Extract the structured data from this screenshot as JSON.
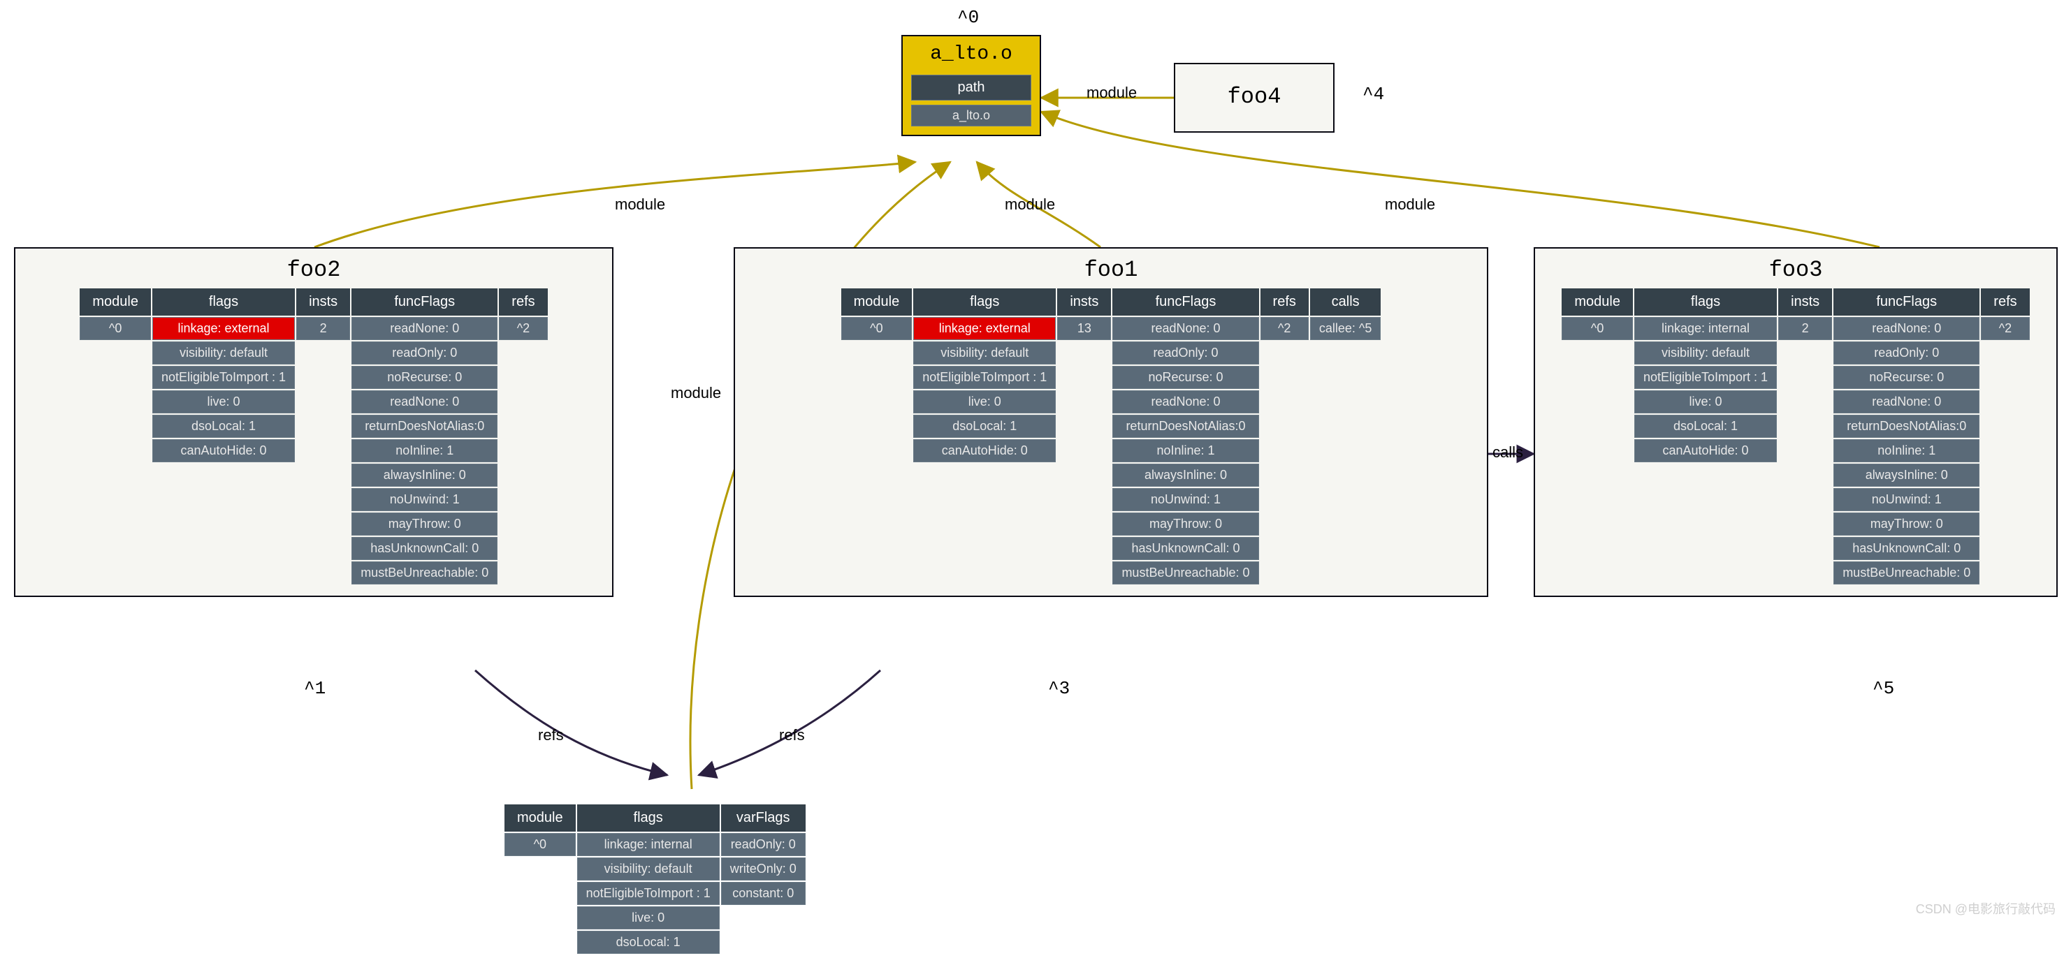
{
  "topNode": {
    "id": "^0",
    "title": "a_lto.o",
    "pathLabel": "path",
    "pathValue": "a_lto.o"
  },
  "foo4": {
    "title": "foo4",
    "id": "^4"
  },
  "foo2": {
    "title": "foo2",
    "id": "^1",
    "headers": [
      "module",
      "flags",
      "insts",
      "funcFlags",
      "refs"
    ],
    "module": "^0",
    "insts": "2",
    "refs": "^2",
    "flags": [
      "linkage: external",
      "visibility: default",
      "notEligibleToImport : 1",
      "live: 0",
      "dsoLocal: 1",
      "canAutoHide: 0"
    ],
    "funcFlags": [
      "readNone: 0",
      "readOnly: 0",
      "noRecurse: 0",
      "readNone: 0",
      "returnDoesNotAlias:0",
      "noInline: 1",
      "alwaysInline: 0",
      "noUnwind: 1",
      "mayThrow: 0",
      "hasUnknownCall: 0",
      "mustBeUnreachable: 0"
    ]
  },
  "foo1": {
    "title": "foo1",
    "id": "^3",
    "headers": [
      "module",
      "flags",
      "insts",
      "funcFlags",
      "refs",
      "calls"
    ],
    "module": "^0",
    "insts": "13",
    "refs": "^2",
    "calls": "callee: ^5",
    "flags": [
      "linkage: external",
      "visibility: default",
      "notEligibleToImport : 1",
      "live: 0",
      "dsoLocal: 1",
      "canAutoHide: 0"
    ],
    "funcFlags": [
      "readNone: 0",
      "readOnly: 0",
      "noRecurse: 0",
      "readNone: 0",
      "returnDoesNotAlias:0",
      "noInline: 1",
      "alwaysInline: 0",
      "noUnwind: 1",
      "mayThrow: 0",
      "hasUnknownCall: 0",
      "mustBeUnreachable: 0"
    ]
  },
  "foo3": {
    "title": "foo3",
    "id": "^5",
    "headers": [
      "module",
      "flags",
      "insts",
      "funcFlags",
      "refs"
    ],
    "module": "^0",
    "insts": "2",
    "refs": "^2",
    "flags": [
      "linkage: internal",
      "visibility: default",
      "notEligibleToImport : 1",
      "live: 0",
      "dsoLocal: 1",
      "canAutoHide: 0"
    ],
    "funcFlags": [
      "readNone: 0",
      "readOnly: 0",
      "noRecurse: 0",
      "readNone: 0",
      "returnDoesNotAlias:0",
      "noInline: 1",
      "alwaysInline: 0",
      "noUnwind: 1",
      "mayThrow: 0",
      "hasUnknownCall: 0",
      "mustBeUnreachable: 0"
    ]
  },
  "varNode": {
    "headers": [
      "module",
      "flags",
      "varFlags"
    ],
    "module": "^0",
    "flags": [
      "linkage: internal",
      "visibility: default",
      "notEligibleToImport : 1",
      "live: 0",
      "dsoLocal: 1"
    ],
    "varFlags": [
      "readOnly: 0",
      "writeOnly: 0",
      "constant: 0"
    ]
  },
  "edgeLabels": {
    "module": "module",
    "refs": "refs",
    "calls": "calls"
  },
  "watermark": "CSDN @电影旅行敲代码"
}
